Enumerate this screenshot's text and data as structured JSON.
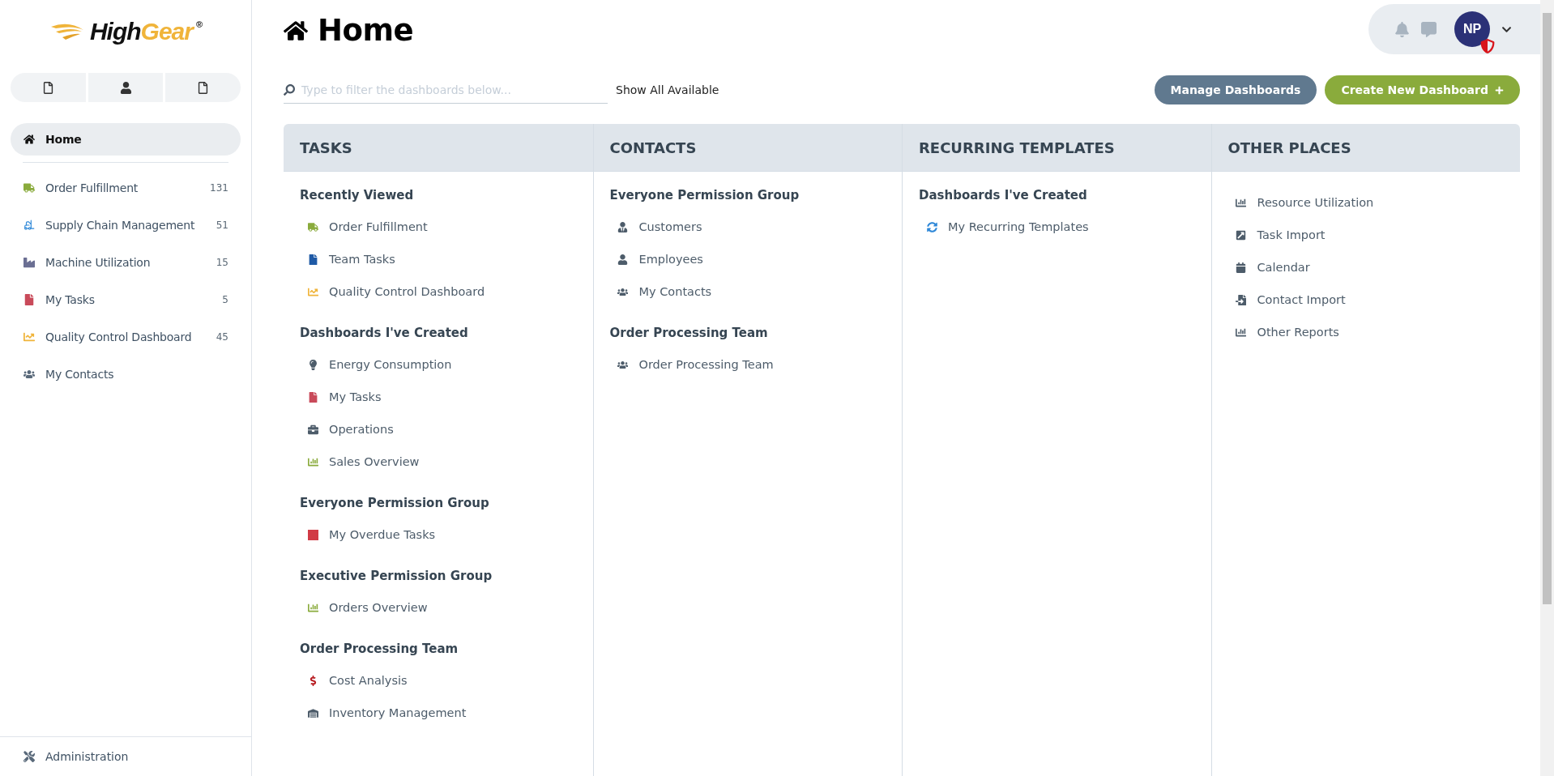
{
  "logo": {
    "word_1": "High",
    "word_2": "Gear",
    "mark": "®"
  },
  "sidebar": {
    "items": [
      {
        "label": "Home",
        "selected": true
      },
      {
        "label": "Order Fulfillment",
        "count": "131",
        "selected": false
      },
      {
        "label": "Supply Chain Management",
        "count": "51",
        "selected": false
      },
      {
        "label": "Machine Utilization",
        "count": "15",
        "selected": false
      },
      {
        "label": "My Tasks",
        "count": "5",
        "selected": false
      },
      {
        "label": "Quality Control Dashboard",
        "count": "45",
        "selected": false
      },
      {
        "label": "My Contacts",
        "selected": false
      }
    ],
    "footer_item": {
      "label": "Administration"
    }
  },
  "page": {
    "title": "Home"
  },
  "filter": {
    "placeholder": "Type to filter the dashboards below...",
    "link": "Show All Available"
  },
  "user": {
    "initials": "NP"
  },
  "buttons": [
    {
      "label": "Manage Dashboards",
      "kind": "secondary"
    },
    {
      "label": "Create New Dashboard",
      "kind": "primary"
    }
  ],
  "columns": [
    {
      "title": "TASKS",
      "groups": [
        {
          "title": "Recently Viewed",
          "items": [
            "Order Fulfillment",
            "Team Tasks",
            "Quality Control Dashboard"
          ]
        },
        {
          "title": "Dashboards I've Created",
          "items": [
            "Energy Consumption",
            "My Tasks",
            "Operations",
            "Sales Overview"
          ]
        },
        {
          "title": "Everyone Permission Group",
          "items": [
            "My Overdue Tasks"
          ]
        },
        {
          "title": "Executive Permission Group",
          "items": [
            "Orders Overview"
          ]
        },
        {
          "title": "Order Processing Team",
          "items": [
            "Cost Analysis",
            "Inventory Management"
          ]
        }
      ]
    },
    {
      "title": "CONTACTS",
      "groups": [
        {
          "title": "Everyone Permission Group",
          "items": [
            "Customers",
            "Employees",
            "My Contacts"
          ]
        },
        {
          "title": "Order Processing Team",
          "items": [
            "Order Processing Team"
          ]
        }
      ]
    },
    {
      "title": "RECURRING TEMPLATES",
      "groups": [
        {
          "title": "Dashboards I've Created",
          "items": [
            "My Recurring Templates"
          ]
        }
      ]
    },
    {
      "title": "OTHER PLACES",
      "groups": [
        {
          "items": [
            "Resource Utilization",
            "Task Import",
            "Calendar",
            "Contact Import",
            "Other Reports"
          ]
        }
      ]
    }
  ]
}
